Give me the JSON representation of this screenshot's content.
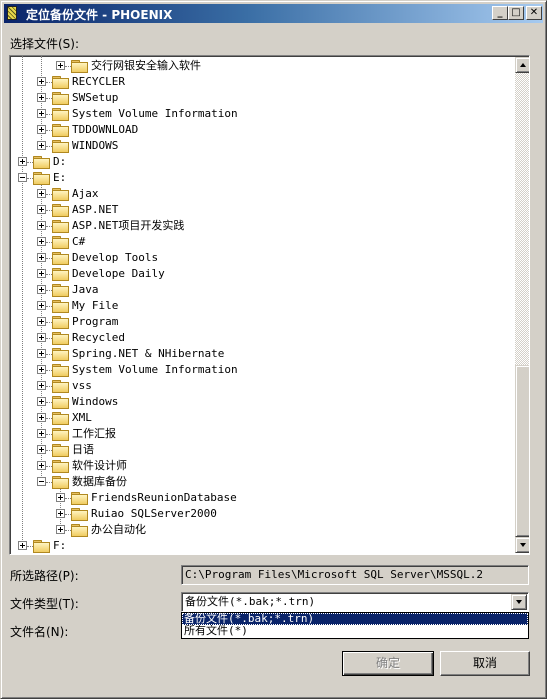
{
  "window": {
    "title": "定位备份文件 - PHOENIX",
    "controls": {
      "minimize": "_",
      "maximize": "□",
      "close": "✕"
    }
  },
  "select_file_label": "选择文件(S):",
  "tree": {
    "rows": [
      {
        "level": 3,
        "label": "交行网银安全输入软件",
        "expanded": false
      },
      {
        "level": 2,
        "label": "RECYCLER",
        "expanded": false
      },
      {
        "level": 2,
        "label": "SWSetup",
        "expanded": false
      },
      {
        "level": 2,
        "label": "System Volume Information",
        "expanded": false
      },
      {
        "level": 2,
        "label": "TDDOWNLOAD",
        "expanded": false
      },
      {
        "level": 2,
        "label": "WINDOWS",
        "expanded": false
      },
      {
        "level": 1,
        "label": "D:",
        "expanded": false
      },
      {
        "level": 1,
        "label": "E:",
        "expanded": true
      },
      {
        "level": 2,
        "label": "Ajax",
        "expanded": false
      },
      {
        "level": 2,
        "label": "ASP.NET",
        "expanded": false
      },
      {
        "level": 2,
        "label": "ASP.NET项目开发实践",
        "expanded": false
      },
      {
        "level": 2,
        "label": "C#",
        "expanded": false
      },
      {
        "level": 2,
        "label": "Develop Tools",
        "expanded": false
      },
      {
        "level": 2,
        "label": "Develope Daily",
        "expanded": false
      },
      {
        "level": 2,
        "label": "Java",
        "expanded": false
      },
      {
        "level": 2,
        "label": "My File",
        "expanded": false
      },
      {
        "level": 2,
        "label": "Program",
        "expanded": false
      },
      {
        "level": 2,
        "label": "Recycled",
        "expanded": false
      },
      {
        "level": 2,
        "label": "Spring.NET & NHibernate",
        "expanded": false
      },
      {
        "level": 2,
        "label": "System Volume Information",
        "expanded": false
      },
      {
        "level": 2,
        "label": "vss",
        "expanded": false
      },
      {
        "level": 2,
        "label": "Windows",
        "expanded": false
      },
      {
        "level": 2,
        "label": "XML",
        "expanded": false
      },
      {
        "level": 2,
        "label": "工作汇报",
        "expanded": false
      },
      {
        "level": 2,
        "label": "日语",
        "expanded": false
      },
      {
        "level": 2,
        "label": "软件设计师",
        "expanded": false
      },
      {
        "level": 2,
        "label": "数据库备份",
        "expanded": true
      },
      {
        "level": 3,
        "label": "FriendsReunionDatabase",
        "expanded": false
      },
      {
        "level": 3,
        "label": "Ruiao SQLServer2000",
        "expanded": false
      },
      {
        "level": 3,
        "label": "办公自动化",
        "expanded": false
      },
      {
        "level": 1,
        "label": "F:",
        "expanded": false
      }
    ],
    "scroll_position_fraction": 0.65
  },
  "form": {
    "path_label": "所选路径(P):",
    "path_value": "C:\\Program Files\\Microsoft SQL Server\\MSSQL.2",
    "filetype_label": "文件类型(T):",
    "filetype_value": "备份文件(*.bak;*.trn)",
    "filetype_options": [
      "备份文件(*.bak;*.trn)",
      "所有文件(*)"
    ],
    "filetype_selected_index": 0,
    "filename_label": "文件名(N):",
    "filename_value": ""
  },
  "buttons": {
    "ok": "确定",
    "cancel": "取消"
  }
}
